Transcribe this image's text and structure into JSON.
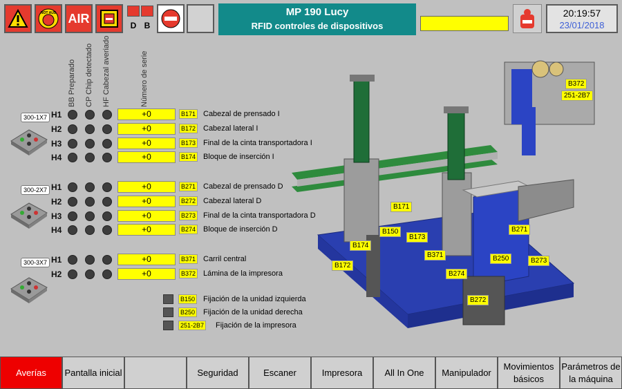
{
  "header": {
    "title": "MP 190 Lucy",
    "subtitle": "RFID controles de dispositivos",
    "air_label": "AIR",
    "d_label": "D",
    "b_label": "B",
    "time": "20:19:57",
    "date": "23/01/2018",
    "estop_text": "NOT AUS"
  },
  "columns": [
    "BB Preparado",
    "CP Chip detectado",
    "HF Cabezal averiado",
    "Número de serie"
  ],
  "groups": [
    {
      "device": "300-1X7",
      "rows": [
        {
          "h": "H1",
          "value": "+0",
          "tag": "B171",
          "desc": "Cabezal de prensado I"
        },
        {
          "h": "H2",
          "value": "+0",
          "tag": "B172",
          "desc": "Cabezal lateral I"
        },
        {
          "h": "H3",
          "value": "+0",
          "tag": "B173",
          "desc": "Final de la cinta transportadora I"
        },
        {
          "h": "H4",
          "value": "+0",
          "tag": "B174",
          "desc": "Bloque de inserción I"
        }
      ]
    },
    {
      "device": "300-2X7",
      "rows": [
        {
          "h": "H1",
          "value": "+0",
          "tag": "B271",
          "desc": "Cabezal de prensado D"
        },
        {
          "h": "H2",
          "value": "+0",
          "tag": "B272",
          "desc": "Cabezal lateral D"
        },
        {
          "h": "H3",
          "value": "+0",
          "tag": "B273",
          "desc": "Final de la cinta transportadora D"
        },
        {
          "h": "H4",
          "value": "+0",
          "tag": "B274",
          "desc": "Bloque de inserción D"
        }
      ]
    },
    {
      "device": "300-3X7",
      "rows": [
        {
          "h": "H1",
          "value": "+0",
          "tag": "B371",
          "desc": "Carril central"
        },
        {
          "h": "H2",
          "value": "+0",
          "tag": "B372",
          "desc": "Lámina de la impresora"
        }
      ]
    }
  ],
  "fixations": [
    {
      "tag": "B150",
      "desc": "Fijación de la unidad izquierda"
    },
    {
      "tag": "B250",
      "desc": "Fijación de la unidad derecha"
    },
    {
      "tag": "251-2B7",
      "desc": "Fijación de la impresora"
    }
  ],
  "machine_tags": [
    "B171",
    "B150",
    "B173",
    "B174",
    "B172",
    "B371",
    "B274",
    "B272",
    "B250",
    "B271",
    "B273",
    "B372",
    "251-2B7"
  ],
  "nav": [
    {
      "label": "Averías",
      "active": true
    },
    {
      "label": "Pantalla inicial"
    },
    {
      "label": ""
    },
    {
      "label": "Seguridad"
    },
    {
      "label": "Escaner"
    },
    {
      "label": "Impresora"
    },
    {
      "label": "All In One"
    },
    {
      "label": "Manipulador"
    },
    {
      "label": "Movimientos básicos"
    },
    {
      "label": "Parámetros de la máquina"
    }
  ],
  "colors": {
    "title_bg": "#128a8a",
    "alarm_red": "#e53a2e",
    "value_yellow": "#ffff00",
    "nav_active": "#ee0000"
  }
}
